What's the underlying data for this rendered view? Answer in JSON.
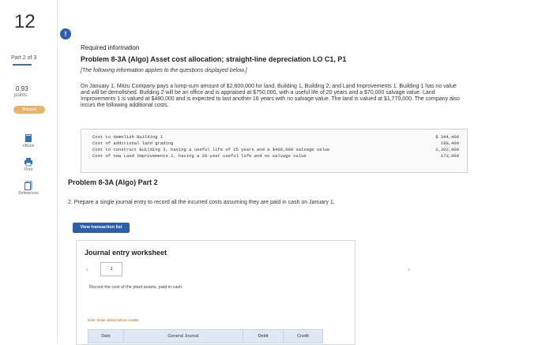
{
  "question_number": "12",
  "sidebar": {
    "part": "Part 2 of 3",
    "points_value": "0.93",
    "points_label": "points",
    "status_badge": "Skipped",
    "tools": [
      {
        "label": "eBook",
        "icon": "book-icon"
      },
      {
        "label": "Print",
        "icon": "printer-icon"
      },
      {
        "label": "References",
        "icon": "references-icon"
      }
    ]
  },
  "alert_symbol": "!",
  "required": "Required information",
  "problem_title": "Problem 8-3A (Algo) Asset cost allocation; straight-line depreciation LO C1, P1",
  "info_note": "[The following information applies to the questions displayed below.]",
  "paragraph": "On January 1, Mitzu Company pays a lump-sum amount of $2,600,000 for land, Building 1, Building 2, and Land Improvements 1. Building 1 has no value and will be demolished. Building 2 will be an office and is appraised at $750,000, with a useful life of 20 years and a $70,000 salvage value. Land Improvements 1 is valued at $480,000 and is expected to last another 16 years with no salvage value. The land is valued at $1,770,000. The company also incurs the following additional costs.",
  "costs": [
    {
      "label": "Cost to demolish Building 1",
      "value": "$ 344,400"
    },
    {
      "label": "Cost of additional land grading",
      "value": "189,400"
    },
    {
      "label": "Cost to construct Building 3, having a useful life of 25 years and a $400,000 salvage value",
      "value": "2,202,000"
    },
    {
      "label": "Cost of new Land Improvements 2, having a 20-year useful life and no salvage value",
      "value": "173,000"
    }
  ],
  "part2_title": "Problem 8-3A (Algo) Part 2",
  "question2": "2. Prepare a single journal entry to record all the incurred costs assuming they are paid in cash on January 1.",
  "view_transaction_button": "View transaction list",
  "journal": {
    "title": "Journal entry worksheet",
    "page": "1",
    "description": "Record the cost of the plant assets, paid in cash.",
    "note": "Note: Enter debits before credits.",
    "columns": [
      "Date",
      "General Journal",
      "Debit",
      "Credit"
    ]
  }
}
